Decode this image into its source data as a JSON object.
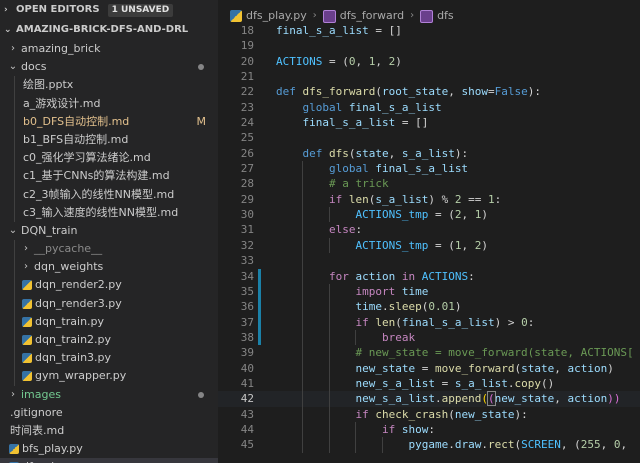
{
  "sidebar": {
    "open_editors": {
      "title": "OPEN EDITORS",
      "badge": "1 UNSAVED"
    },
    "project": {
      "title": "AMAZING-BRICK-DFS-AND-DRL"
    },
    "items": [
      {
        "label": "amazing_brick",
        "kind": "folder",
        "state": "collapsed",
        "depth": 0
      },
      {
        "label": "docs",
        "kind": "folder",
        "state": "expanded",
        "depth": 0,
        "dot": true
      },
      {
        "label": "绘图.pptx",
        "kind": "ppt",
        "depth": 1
      },
      {
        "label": "a_游戏设计.md",
        "kind": "md",
        "depth": 1
      },
      {
        "label": "b0_DFS自动控制.md",
        "kind": "md",
        "depth": 1,
        "modified": "M",
        "color": "#e2c08d"
      },
      {
        "label": "b1_BFS自动控制.md",
        "kind": "md",
        "depth": 1
      },
      {
        "label": "c0_强化学习算法绪论.md",
        "kind": "md",
        "depth": 1
      },
      {
        "label": "c1_基于CNNs的算法构建.md",
        "kind": "md",
        "depth": 1
      },
      {
        "label": "c2_3帧输入的线性NN模型.md",
        "kind": "md",
        "depth": 1
      },
      {
        "label": "c3_输入速度的线性NN模型.md",
        "kind": "md",
        "depth": 1
      },
      {
        "label": "DQN_train",
        "kind": "folder",
        "state": "expanded",
        "depth": 0
      },
      {
        "label": "__pycache__",
        "kind": "folder",
        "state": "collapsed",
        "depth": 1,
        "color": "#8a8a8a"
      },
      {
        "label": "dqn_weights",
        "kind": "folder",
        "state": "collapsed",
        "depth": 1
      },
      {
        "label": "dqn_render2.py",
        "kind": "py",
        "depth": 1
      },
      {
        "label": "dqn_render3.py",
        "kind": "py",
        "depth": 1
      },
      {
        "label": "dqn_train.py",
        "kind": "py",
        "depth": 1
      },
      {
        "label": "dqn_train2.py",
        "kind": "py",
        "depth": 1
      },
      {
        "label": "dqn_train3.py",
        "kind": "py",
        "depth": 1
      },
      {
        "label": "gym_wrapper.py",
        "kind": "py",
        "depth": 1
      },
      {
        "label": "images",
        "kind": "folder",
        "state": "collapsed",
        "depth": 0,
        "dot": true,
        "color": "#73c991"
      },
      {
        "label": ".gitignore",
        "kind": "git",
        "depth": 0
      },
      {
        "label": "时间表.md",
        "kind": "md",
        "depth": 0
      },
      {
        "label": "bfs_play.py",
        "kind": "py",
        "depth": 0
      },
      {
        "label": "dfs_play.py",
        "kind": "py",
        "depth": 0,
        "active": true
      }
    ]
  },
  "breadcrumb": {
    "file": "dfs_play.py",
    "func1": "dfs_forward",
    "func2": "dfs"
  },
  "code": {
    "current_line": 42,
    "lines": [
      {
        "n": 18,
        "indent": 0,
        "tokens": [
          [
            "var",
            "final_s_a_list"
          ],
          [
            "txt",
            " = []"
          ]
        ]
      },
      {
        "n": 19,
        "indent": 0,
        "tokens": []
      },
      {
        "n": 20,
        "indent": 0,
        "tokens": [
          [
            "const",
            "ACTIONS"
          ],
          [
            "txt",
            " = ("
          ],
          [
            "num",
            "0"
          ],
          [
            "txt",
            ", "
          ],
          [
            "num",
            "1"
          ],
          [
            "txt",
            ", "
          ],
          [
            "num",
            "2"
          ],
          [
            "txt",
            ")"
          ]
        ]
      },
      {
        "n": 21,
        "indent": 0,
        "tokens": []
      },
      {
        "n": 22,
        "indent": 0,
        "tokens": [
          [
            "kw",
            "def "
          ],
          [
            "fn",
            "dfs_forward"
          ],
          [
            "txt",
            "("
          ],
          [
            "var",
            "root_state"
          ],
          [
            "txt",
            ", "
          ],
          [
            "var",
            "show"
          ],
          [
            "txt",
            "="
          ],
          [
            "kw",
            "False"
          ],
          [
            "txt",
            "):"
          ]
        ]
      },
      {
        "n": 23,
        "indent": 1,
        "tokens": [
          [
            "kw",
            "global "
          ],
          [
            "var",
            "final_s_a_list"
          ]
        ]
      },
      {
        "n": 24,
        "indent": 1,
        "tokens": [
          [
            "var",
            "final_s_a_list"
          ],
          [
            "txt",
            " = []"
          ]
        ]
      },
      {
        "n": 25,
        "indent": 1,
        "tokens": []
      },
      {
        "n": 26,
        "indent": 1,
        "tokens": [
          [
            "kw",
            "def "
          ],
          [
            "fn",
            "dfs"
          ],
          [
            "txt",
            "("
          ],
          [
            "var",
            "state"
          ],
          [
            "txt",
            ", "
          ],
          [
            "var",
            "s_a_list"
          ],
          [
            "txt",
            "):"
          ]
        ]
      },
      {
        "n": 27,
        "indent": 2,
        "tokens": [
          [
            "kw",
            "global "
          ],
          [
            "var",
            "final_s_a_list"
          ]
        ]
      },
      {
        "n": 28,
        "indent": 2,
        "tokens": [
          [
            "cmt",
            "# a trick"
          ]
        ]
      },
      {
        "n": 29,
        "indent": 2,
        "tokens": [
          [
            "ctl",
            "if "
          ],
          [
            "fn",
            "len"
          ],
          [
            "txt",
            "("
          ],
          [
            "var",
            "s_a_list"
          ],
          [
            "txt",
            ") % "
          ],
          [
            "num",
            "2"
          ],
          [
            "txt",
            " == "
          ],
          [
            "num",
            "1"
          ],
          [
            "txt",
            ":"
          ]
        ]
      },
      {
        "n": 30,
        "indent": 3,
        "tokens": [
          [
            "const",
            "ACTIONS_tmp"
          ],
          [
            "txt",
            " = ("
          ],
          [
            "num",
            "2"
          ],
          [
            "txt",
            ", "
          ],
          [
            "num",
            "1"
          ],
          [
            "txt",
            ")"
          ]
        ]
      },
      {
        "n": 31,
        "indent": 2,
        "tokens": [
          [
            "ctl",
            "else"
          ],
          [
            "txt",
            ":"
          ]
        ]
      },
      {
        "n": 32,
        "indent": 3,
        "tokens": [
          [
            "const",
            "ACTIONS_tmp"
          ],
          [
            "txt",
            " = ("
          ],
          [
            "num",
            "1"
          ],
          [
            "txt",
            ", "
          ],
          [
            "num",
            "2"
          ],
          [
            "txt",
            ")"
          ]
        ]
      },
      {
        "n": 33,
        "indent": 2,
        "tokens": []
      },
      {
        "n": 34,
        "indent": 2,
        "tokens": [
          [
            "ctl",
            "for "
          ],
          [
            "var",
            "action"
          ],
          [
            "ctl",
            " in "
          ],
          [
            "const",
            "ACTIONS"
          ],
          [
            "txt",
            ":"
          ]
        ],
        "changed": true
      },
      {
        "n": 35,
        "indent": 3,
        "tokens": [
          [
            "ctl",
            "import "
          ],
          [
            "var",
            "time"
          ]
        ],
        "changed": true
      },
      {
        "n": 36,
        "indent": 3,
        "tokens": [
          [
            "var",
            "time"
          ],
          [
            "txt",
            "."
          ],
          [
            "fn",
            "sleep"
          ],
          [
            "txt",
            "("
          ],
          [
            "num",
            "0.01"
          ],
          [
            "txt",
            ")"
          ]
        ],
        "changed": true
      },
      {
        "n": 37,
        "indent": 3,
        "tokens": [
          [
            "ctl",
            "if "
          ],
          [
            "fn",
            "len"
          ],
          [
            "txt",
            "("
          ],
          [
            "var",
            "final_s_a_list"
          ],
          [
            "txt",
            ") > "
          ],
          [
            "num",
            "0"
          ],
          [
            "txt",
            ":"
          ]
        ],
        "changed": true
      },
      {
        "n": 38,
        "indent": 4,
        "tokens": [
          [
            "ctl",
            "break"
          ]
        ],
        "changed": true
      },
      {
        "n": 39,
        "indent": 3,
        "tokens": [
          [
            "cmt",
            "# new_state = move_forward(state, ACTIONS["
          ]
        ]
      },
      {
        "n": 40,
        "indent": 3,
        "tokens": [
          [
            "var",
            "new_state"
          ],
          [
            "txt",
            " = "
          ],
          [
            "fn",
            "move_forward"
          ],
          [
            "txt",
            "("
          ],
          [
            "var",
            "state"
          ],
          [
            "txt",
            ", "
          ],
          [
            "var",
            "action"
          ],
          [
            "txt",
            ")"
          ]
        ]
      },
      {
        "n": 41,
        "indent": 3,
        "tokens": [
          [
            "var",
            "new_s_a_list"
          ],
          [
            "txt",
            " = "
          ],
          [
            "var",
            "s_a_list"
          ],
          [
            "txt",
            "."
          ],
          [
            "fn",
            "copy"
          ],
          [
            "txt",
            "()"
          ]
        ]
      },
      {
        "n": 42,
        "indent": 3,
        "tokens": [
          [
            "var",
            "new_s_a_list"
          ],
          [
            "txt",
            "."
          ],
          [
            "fn",
            "append"
          ],
          [
            "br",
            "("
          ],
          [
            "br2box",
            "("
          ],
          [
            "var",
            "new_state"
          ],
          [
            "txt",
            ", "
          ],
          [
            "var",
            "action"
          ],
          [
            "br2",
            "))"
          ]
        ]
      },
      {
        "n": 43,
        "indent": 3,
        "tokens": [
          [
            "ctl",
            "if "
          ],
          [
            "fn",
            "check_crash"
          ],
          [
            "txt",
            "("
          ],
          [
            "var",
            "new_state"
          ],
          [
            "txt",
            "):"
          ]
        ]
      },
      {
        "n": 44,
        "indent": 4,
        "tokens": [
          [
            "ctl",
            "if "
          ],
          [
            "var",
            "show"
          ],
          [
            "txt",
            ":"
          ]
        ]
      },
      {
        "n": 45,
        "indent": 5,
        "tokens": [
          [
            "var",
            "pygame"
          ],
          [
            "txt",
            "."
          ],
          [
            "var",
            "draw"
          ],
          [
            "txt",
            "."
          ],
          [
            "fn",
            "rect"
          ],
          [
            "txt",
            "("
          ],
          [
            "const",
            "SCREEN"
          ],
          [
            "txt",
            ", ("
          ],
          [
            "num",
            "255"
          ],
          [
            "txt",
            ", "
          ],
          [
            "num",
            "0"
          ],
          [
            "txt",
            ","
          ]
        ]
      }
    ]
  },
  "colors": {
    "sidebar_bg": "#252526",
    "editor_bg": "#1e1e1e",
    "modified": "#e2c08d",
    "untracked": "#73c991"
  }
}
